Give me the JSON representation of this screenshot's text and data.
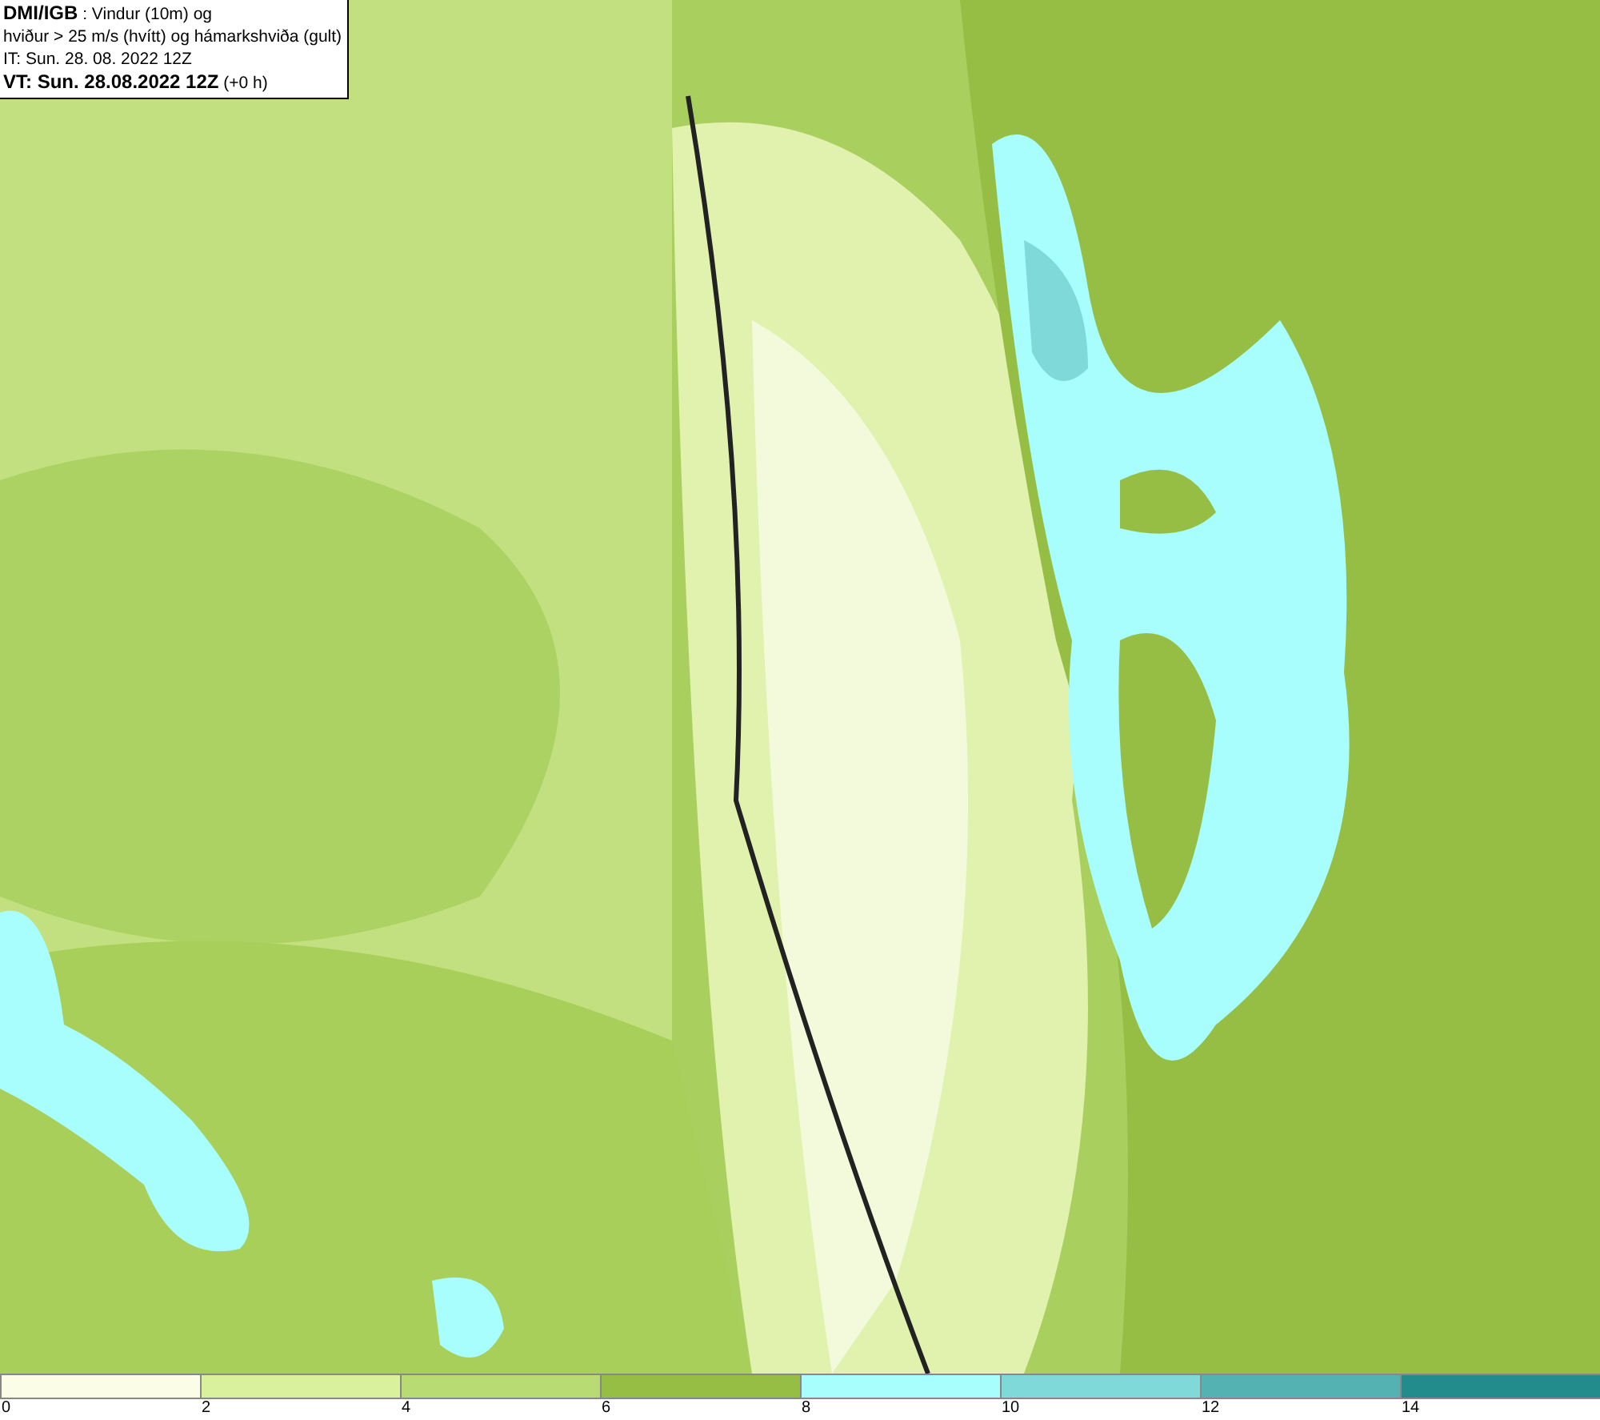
{
  "header": {
    "lines": [
      "**DMI/IGB** : Vindur (10m) og",
      "hviður > 25 m/s (hvítt) og hámarkshviða (gult)",
      "IT: Sun. 28. 08. 2022 12Z",
      "**VT: Sun. 28.08.2022 12Z** (+0 h)"
    ]
  },
  "legend": {
    "segments": [
      {
        "color": "#fbfde6",
        "label": "0"
      },
      {
        "color": "#d9f09d",
        "label": "2"
      },
      {
        "color": "#b8db73",
        "label": "4"
      },
      {
        "color": "#96be44",
        "label": "6"
      },
      {
        "color": "#a8fdfd",
        "label": "8"
      },
      {
        "color": "#7fd9d9",
        "label": "10"
      },
      {
        "color": "#55b2b2",
        "label": "12"
      },
      {
        "color": "#228b8b",
        "label": "14"
      }
    ]
  }
}
